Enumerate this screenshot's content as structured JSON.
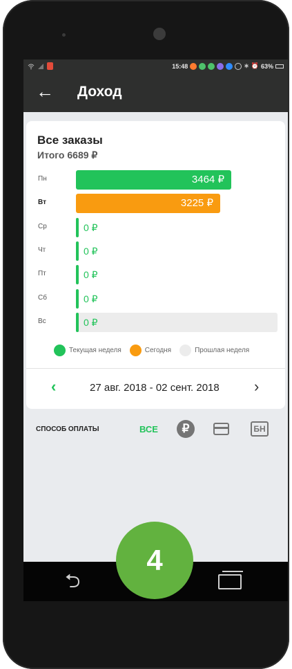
{
  "statusbar": {
    "time": "15:48",
    "battery": "63%",
    "colors": {
      "red": "#e24b3a",
      "orange": "#ff7a2f",
      "green": "#4ec26b",
      "violet": "#8a6de9",
      "blue": "#2f8cff"
    }
  },
  "appbar": {
    "back_icon": "arrow-left-icon",
    "title": "Доход"
  },
  "card": {
    "title": "Все заказы",
    "total": "Итого 6689 ₽"
  },
  "chart_data": {
    "type": "bar",
    "orientation": "horizontal",
    "categories": [
      "Пн",
      "Вт",
      "Ср",
      "Чт",
      "Пт",
      "Сб",
      "Вс"
    ],
    "values": [
      3464,
      3225,
      0,
      0,
      0,
      0,
      0
    ],
    "labels": [
      "3464 ₽",
      "3225 ₽",
      "0 ₽",
      "0 ₽",
      "0 ₽",
      "0 ₽",
      "0 ₽"
    ],
    "colors": [
      "#22c35a",
      "#f99b10",
      "#22c35a",
      "#22c35a",
      "#22c35a",
      "#22c35a",
      "#22c35a"
    ],
    "legend": [
      {
        "name": "Текущая неделя",
        "color": "#22c35a"
      },
      {
        "name": "Сегодня",
        "color": "#f99b10"
      },
      {
        "name": "Прошлая неделя",
        "color": "#ececec"
      }
    ],
    "xlim": [
      0,
      4500
    ]
  },
  "week_nav": {
    "prev_icon": "chevron-left-icon",
    "range": "27 авг. 2018 - 02 сент. 2018",
    "next_icon": "chevron-right-icon"
  },
  "payment": {
    "label": "СПОСОБ ОПЛАТЫ",
    "all": "ВСЕ",
    "rub_symbol": "₽",
    "card_icon": "credit-card-icon",
    "bn": "БН"
  },
  "android_nav": {
    "back_icon": "back-icon",
    "recent_icon": "recent-apps-icon"
  },
  "step_badge": "4",
  "accent": "#22c35a"
}
